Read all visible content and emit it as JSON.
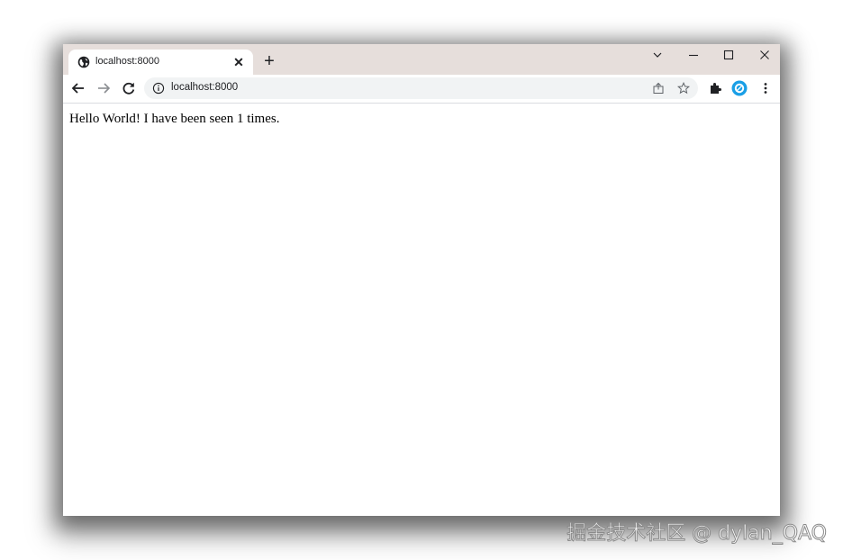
{
  "browser": {
    "tab": {
      "title": "localhost:8000",
      "favicon": "globe-icon",
      "close_glyph": "✕"
    },
    "new_tab_glyph": "+",
    "window_controls": {
      "tab_search_glyph": "⌵",
      "minimize_glyph": "–",
      "maximize_glyph": "☐",
      "close_glyph": "✕"
    },
    "toolbar": {
      "url": "localhost:8000",
      "colors": {
        "tab_strip": "#e6dedb",
        "omnibox": "#f1f3f4",
        "profile_accent": "#1a9fe6"
      }
    }
  },
  "page": {
    "body_text": "Hello World! I have been seen 1 times."
  },
  "watermark": {
    "text": "掘金技术社区 @ dylan_QAQ"
  }
}
